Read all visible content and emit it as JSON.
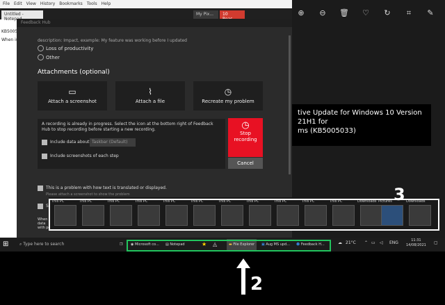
{
  "notepad": {
    "menu": [
      "File",
      "Edit",
      "View",
      "History",
      "Bookmarks",
      "Tools",
      "Help"
    ],
    "tab_title": "Untitled - Notepad",
    "browser_tabs": [
      "My Pix...",
      "10 Reas..."
    ],
    "lines": [
      "KB5005033",
      "When is"
    ]
  },
  "photos": {
    "text": "tive Update for Windows 10 Version 21H1 for\nms (KB5005033)"
  },
  "hub": {
    "title": "Feedback Hub",
    "intro": "description: Impact, example: My feature was working before I updated",
    "options": [
      "Loss of productivity",
      "Other"
    ],
    "attachments_title": "Attachments (optional)",
    "attach_screenshot": "Attach a screenshot",
    "attach_file": "Attach a file",
    "recreate": "Recreate my problem",
    "recording_msg": "A recording is already in progress. Select the icon at the bottom right of Feedback Hub to stop recording before starting a new recording.",
    "include_data": "Include data about",
    "dropdown_value": "Taskbar (Default)",
    "include_screens": "Include screenshots of each step",
    "stop": "Stop\nrecording",
    "cancel": "Cancel",
    "translated": "This is a problem with how text is translated or displayed.",
    "translated_sub": "Please attach a screenshot to show the problem",
    "save": "Sav",
    "when": "When\ndata\nwith po"
  },
  "thumbs": [
    "This PC",
    "This PC",
    "This PC",
    "This PC",
    "This PC",
    "This PC",
    "This PC",
    "This PC",
    "This PC",
    "This PC",
    "This PC",
    "Downloads",
    "Pictures",
    "Downloads"
  ],
  "taskbar": {
    "search": "Type here to search",
    "items": [
      "Microsoft co...",
      "Notepad",
      "",
      "",
      "File Explorer",
      "Aug MS upd...",
      "Feedback H..."
    ],
    "temp": "21°C",
    "lang": "ENG",
    "time": "11:31",
    "date": "14/08/2021"
  },
  "annotations": {
    "callout_3": "3",
    "callout_2": "2"
  }
}
